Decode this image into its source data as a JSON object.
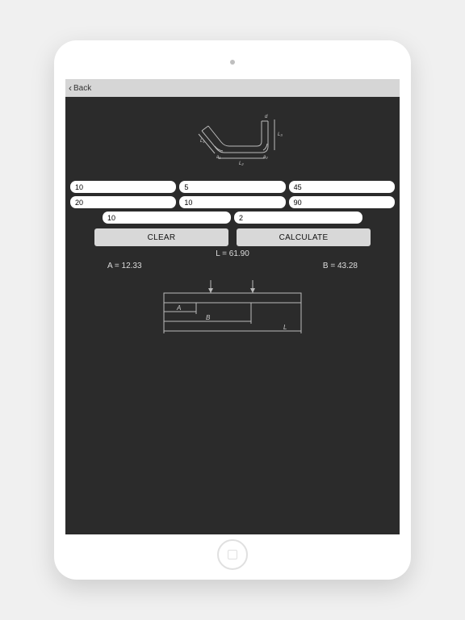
{
  "nav": {
    "back_label": "Back"
  },
  "inputs": {
    "r1c1": "10",
    "r1c2": "5",
    "r1c3": "45",
    "r2c1": "20",
    "r2c2": "10",
    "r2c3": "90",
    "r3c1": "10",
    "r3c2": "2"
  },
  "buttons": {
    "clear": "CLEAR",
    "calculate": "CALCULATE"
  },
  "results": {
    "L": "L = 61.90",
    "A": "A = 12.33",
    "B": "B = 43.28"
  },
  "diagram_top": {
    "labels": {
      "L1": "L₁",
      "L2": "L₂",
      "L3": "L₃",
      "a1": "a₁",
      "a2": "a₂",
      "d": "d"
    }
  },
  "diagram_bottom": {
    "labels": {
      "A": "A",
      "B": "B",
      "L": "L"
    }
  }
}
